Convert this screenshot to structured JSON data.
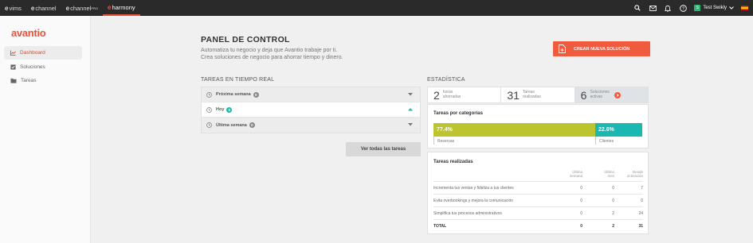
{
  "topbar": {
    "products": [
      {
        "prefix": "e",
        "name": "vims",
        "sup": ""
      },
      {
        "prefix": "e",
        "name": "channel",
        "sup": ""
      },
      {
        "prefix": "e",
        "name": "channel",
        "sup": "PRO"
      },
      {
        "prefix": "e",
        "name": "harmony",
        "sup": ""
      }
    ],
    "active_product": 3,
    "user_initial": "S",
    "user_name": "Test Swikly",
    "icons": [
      "search-icon",
      "mail-icon",
      "bell-icon",
      "help-icon"
    ]
  },
  "sidebar": {
    "logo": "avantio",
    "items": [
      {
        "label": "Dashboard",
        "icon": "chart-icon"
      },
      {
        "label": "Soluciones",
        "icon": "checklist-icon"
      },
      {
        "label": "Tareas",
        "icon": "folder-icon"
      }
    ]
  },
  "header": {
    "title": "PANEL DE CONTROL",
    "subtitle_1": "Automatiza tu negocio y deja que Avantio trabaje por ti.",
    "subtitle_2": "Crea soluciones de negocio para ahorrar tiempo y dinero.",
    "cta_label": "CREAR NUEVA SOLUCIÓN"
  },
  "tasks": {
    "section_label": "TAREAS EN TIEMPO REAL",
    "rows": [
      {
        "label": "Próxima semana",
        "count": "0"
      },
      {
        "label": "Hoy",
        "count": "0"
      },
      {
        "label": "Última semana",
        "count": "0"
      }
    ],
    "view_all": "Ver todas las tareas"
  },
  "stats": {
    "section_label": "ESTADÍSTICA",
    "tabs": [
      {
        "num": "2",
        "l1": "horas",
        "l2": "ahorradas"
      },
      {
        "num": "31",
        "l1": "Tareas",
        "l2": "realizadas"
      },
      {
        "num": "6",
        "l1": "Soluciones",
        "l2": "activas"
      }
    ],
    "categories_title": "Tareas por categorías",
    "categories": [
      {
        "pct": "77.4%",
        "name": "Reservas",
        "share": 0.774,
        "color": "#bcc52f"
      },
      {
        "pct": "22.6%",
        "name": "Clientes",
        "share": 0.226,
        "color": "#1bb8b1"
      }
    ],
    "done_title": "Tareas realizadas",
    "columns": [
      {
        "l1": "Última",
        "l2": "semana"
      },
      {
        "l1": "Último",
        "l2": "mes"
      },
      {
        "l1": "Desde",
        "l2": "activación"
      }
    ],
    "rows": [
      {
        "label": "Incrementa tus ventas y fideliza a tus clientes",
        "week": "0",
        "month": "0",
        "total": "7"
      },
      {
        "label": "Evita overbookings y mejora la comunicación",
        "week": "0",
        "month": "0",
        "total": "0"
      },
      {
        "label": "Simplifica tus procesos administrativos",
        "week": "0",
        "month": "2",
        "total": "24"
      },
      {
        "label": "TOTAL",
        "week": "0",
        "month": "2",
        "total": "31"
      }
    ]
  }
}
